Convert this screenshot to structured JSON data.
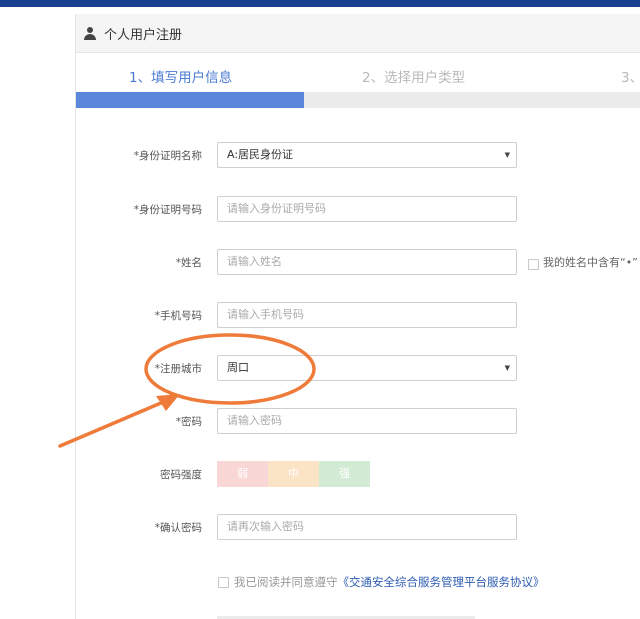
{
  "panel": {
    "title": "个人用户注册",
    "icon": "user-icon"
  },
  "steps": [
    {
      "label": "1、填写用户信息",
      "active": true
    },
    {
      "label": "2、选择用户类型",
      "active": false
    },
    {
      "label": "3、",
      "active": false
    }
  ],
  "progress": {
    "fraction": 0.405,
    "fill_color": "#5b87da",
    "track_color": "#ececec"
  },
  "form": {
    "id_type": {
      "label": "*身份证明名称",
      "value": "A:居民身份证"
    },
    "id_number": {
      "label": "*身份证明号码",
      "placeholder": "请输入身份证明号码"
    },
    "name": {
      "label": "*姓名",
      "placeholder": "请输入姓名",
      "checkbox_label": "我的姓名中含有“•”"
    },
    "phone": {
      "label": "*手机号码",
      "placeholder": "请输入手机号码"
    },
    "city": {
      "label": "*注册城市",
      "value": "周口"
    },
    "password": {
      "label": "*密码",
      "placeholder": "请输入密码"
    },
    "strength": {
      "label": "密码强度",
      "weak": "弱",
      "medium": "中",
      "strong": "强"
    },
    "confirm": {
      "label": "*确认密码",
      "placeholder": "请再次输入密码"
    },
    "agree": {
      "text": "我已阅读并同意遵守",
      "link": "《交通安全综合服务管理平台服务协议》"
    }
  },
  "colors": {
    "accent": "#4a7bd0",
    "annotation": "#ee7b3a",
    "topbar": "#1a3f8f"
  }
}
